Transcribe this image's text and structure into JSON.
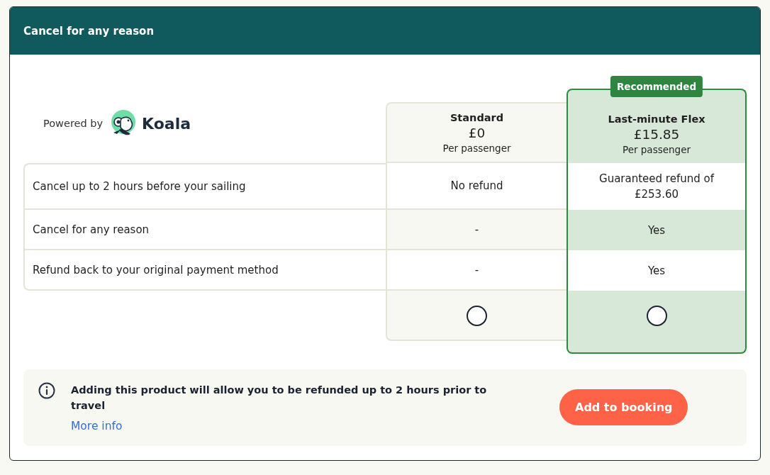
{
  "header": {
    "title": "Cancel for any reason"
  },
  "provider": {
    "label": "Powered by",
    "name": "Koala"
  },
  "plans": [
    {
      "name": "Standard",
      "price": "£0",
      "unit": "Per passenger",
      "recommended": false,
      "selected": false
    },
    {
      "name": "Last-minute Flex",
      "price": "£15.85",
      "unit": "Per passenger",
      "recommended": true,
      "badge": "Recommended",
      "selected": false
    }
  ],
  "features": [
    {
      "label": "Cancel up to 2 hours before your sailing",
      "values": [
        "No refund",
        "Guaranteed refund of £253.60"
      ]
    },
    {
      "label": "Cancel for any reason",
      "values": [
        "-",
        "Yes"
      ]
    },
    {
      "label": "Refund back to your original payment method",
      "values": [
        "-",
        "Yes"
      ]
    }
  ],
  "info": {
    "message": "Adding this product will allow you to be refunded up to 2 hours prior to travel",
    "link": "More info",
    "button": "Add to booking"
  }
}
